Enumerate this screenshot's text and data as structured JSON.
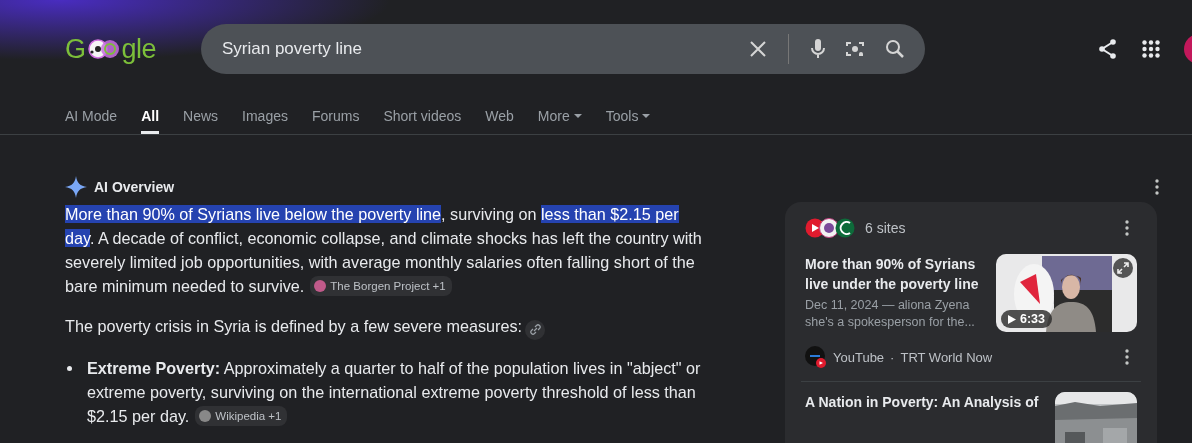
{
  "logo": {
    "before": "G",
    "after": "gle"
  },
  "search": {
    "value": "Syrian poverty line"
  },
  "tabs": [
    {
      "label": "AI Mode",
      "selected": false,
      "dropdown": false
    },
    {
      "label": "All",
      "selected": true,
      "dropdown": false
    },
    {
      "label": "News",
      "selected": false,
      "dropdown": false
    },
    {
      "label": "Images",
      "selected": false,
      "dropdown": false
    },
    {
      "label": "Forums",
      "selected": false,
      "dropdown": false
    },
    {
      "label": "Short videos",
      "selected": false,
      "dropdown": false
    },
    {
      "label": "Web",
      "selected": false,
      "dropdown": false
    },
    {
      "label": "More",
      "selected": false,
      "dropdown": true
    },
    {
      "label": "Tools",
      "selected": false,
      "dropdown": true
    }
  ],
  "ai_overview": {
    "title": "AI Overview",
    "paragraph": {
      "segments": [
        {
          "text": "More than 90% of Syrians live below the poverty line",
          "highlighted": true
        },
        {
          "text": ", surviving on ",
          "highlighted": false
        },
        {
          "text": "less than $2.15 per day",
          "highlighted": true
        },
        {
          "text": ". A decade of conflict, economic collapse, and climate shocks has left the country with severely limited job opportunities, with average monthly salaries often falling short of the bare minimum needed to survive.",
          "highlighted": false
        }
      ],
      "citation": "The Borgen Project +1"
    },
    "intro": "The poverty crisis in Syria is defined by a few severe measures:",
    "bullets": [
      {
        "text": "**Extreme Poverty:** Approximately a quarter to half of the population lives in \"abject\" or extreme poverty, surviving on the international extreme poverty threshold of less than $2.15 per day.",
        "citation": "Wikipedia +1"
      }
    ]
  },
  "sources": {
    "count": "6 sites",
    "items": [
      {
        "kind": "video",
        "title": "More than 90% of Syrians live under the poverty line",
        "snippet": "Dec 11, 2024 — aliona Zyena she's a spokesperson for the...",
        "duration": "6:33",
        "site": "YouTube",
        "separator": "·",
        "channel": "TRT World Now"
      },
      {
        "kind": "article",
        "title": "A Nation in Poverty: An Analysis of"
      }
    ]
  }
}
